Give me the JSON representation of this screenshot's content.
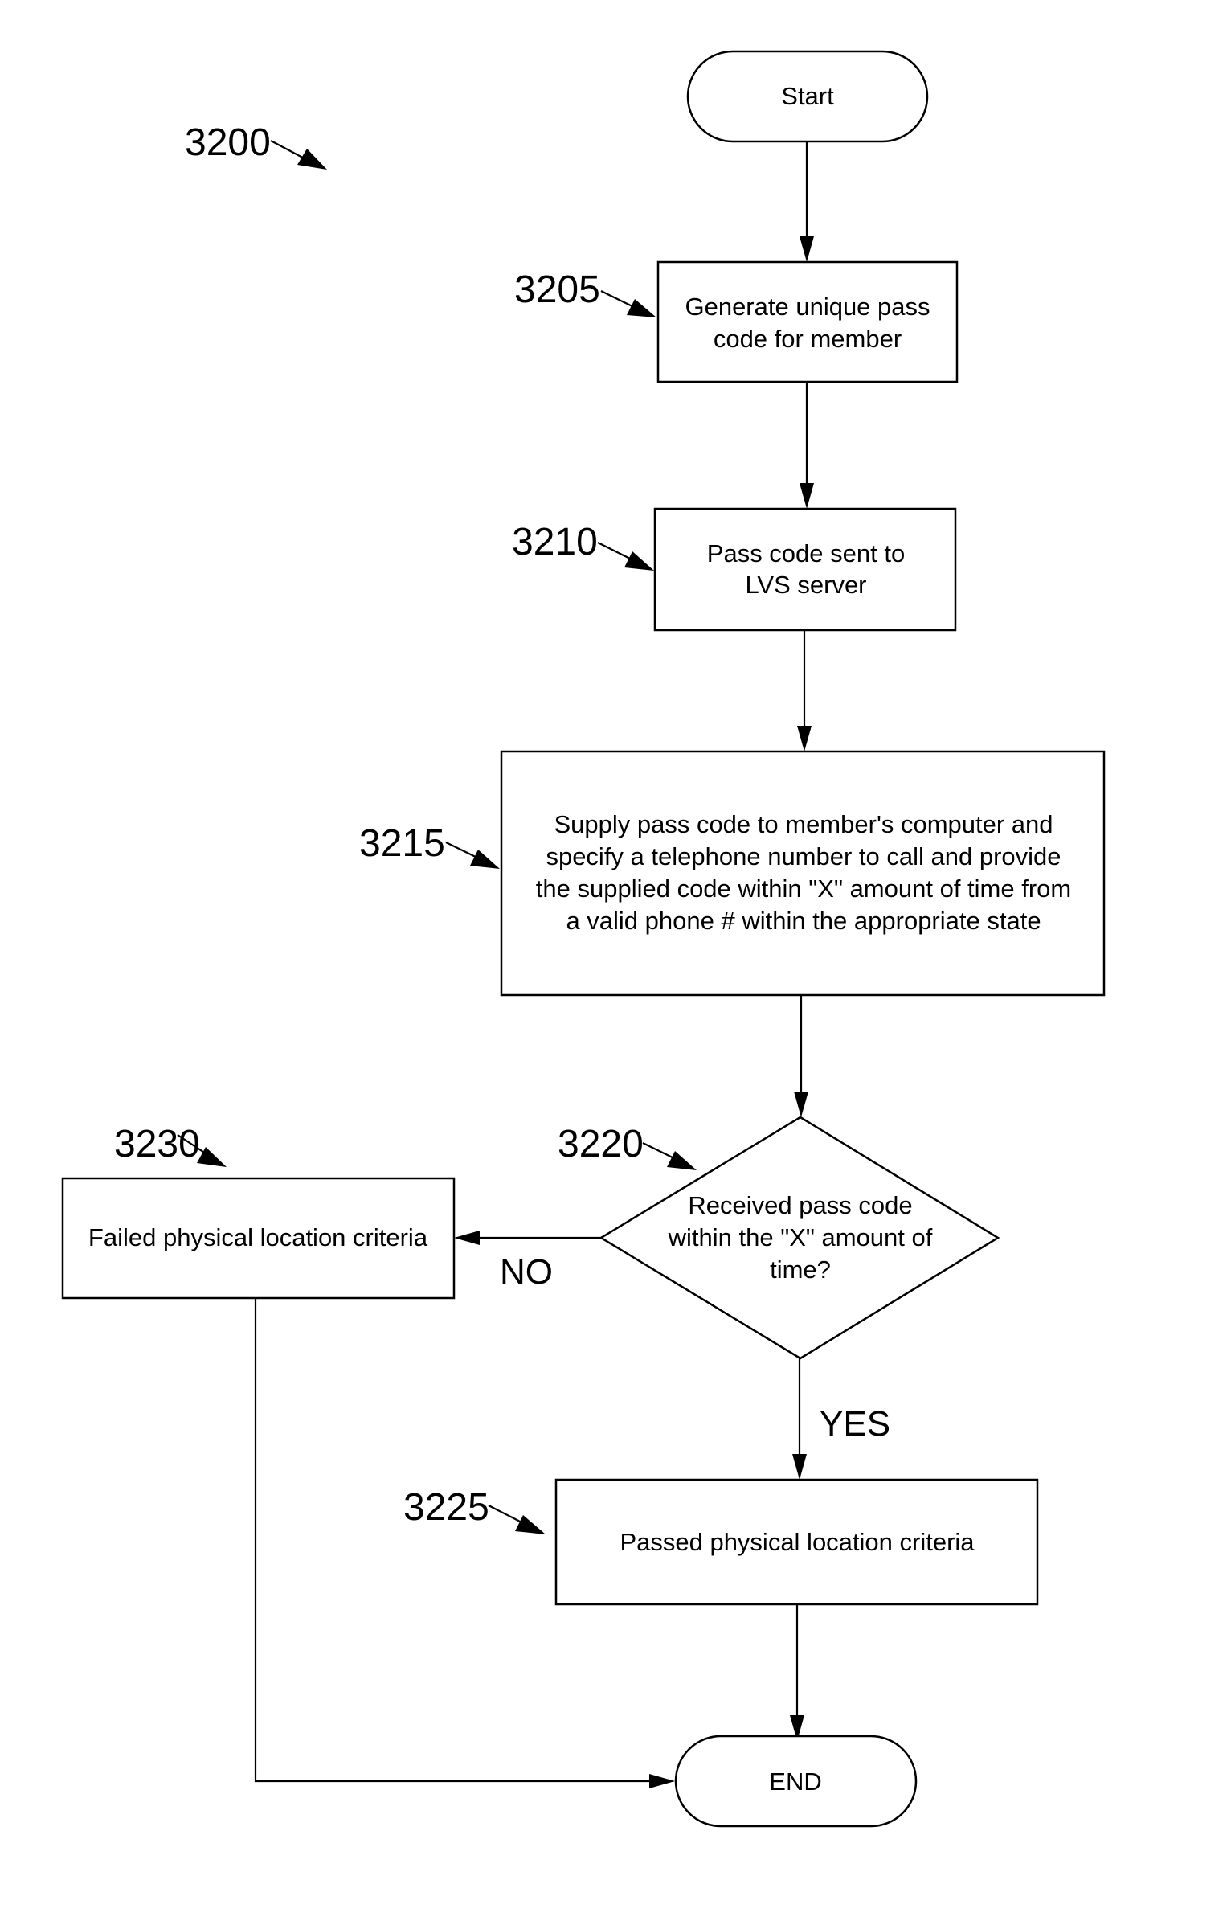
{
  "figure": {
    "reference": "3200"
  },
  "nodes": {
    "start": {
      "text": "Start"
    },
    "s3205": {
      "ref": "3205",
      "lines": [
        "Generate unique pass",
        "code for member"
      ]
    },
    "s3210": {
      "ref": "3210",
      "lines": [
        "Pass code sent to",
        "LVS server"
      ]
    },
    "s3215": {
      "ref": "3215",
      "lines": [
        "Supply pass code to member's computer and",
        "specify a telephone number to call and provide",
        "the supplied code within \"X\" amount of time from",
        "a valid phone # within the appropriate state"
      ]
    },
    "s3220": {
      "ref": "3220",
      "lines": [
        "Received pass code",
        "within the \"X\" amount of",
        "time?"
      ]
    },
    "s3225": {
      "ref": "3225",
      "lines": [
        "Passed physical location criteria"
      ]
    },
    "s3230": {
      "ref": "3230",
      "lines": [
        "Failed physical location criteria"
      ]
    },
    "end": {
      "text": "END"
    }
  },
  "branches": {
    "no": "NO",
    "yes": "YES"
  },
  "edges": [
    {
      "from": "start",
      "to": "s3205"
    },
    {
      "from": "s3205",
      "to": "s3210"
    },
    {
      "from": "s3210",
      "to": "s3215"
    },
    {
      "from": "s3215",
      "to": "s3220"
    },
    {
      "from": "s3220",
      "to": "s3230",
      "label": "NO"
    },
    {
      "from": "s3220",
      "to": "s3225",
      "label": "YES"
    },
    {
      "from": "s3225",
      "to": "end"
    },
    {
      "from": "s3230",
      "to": "end"
    }
  ]
}
